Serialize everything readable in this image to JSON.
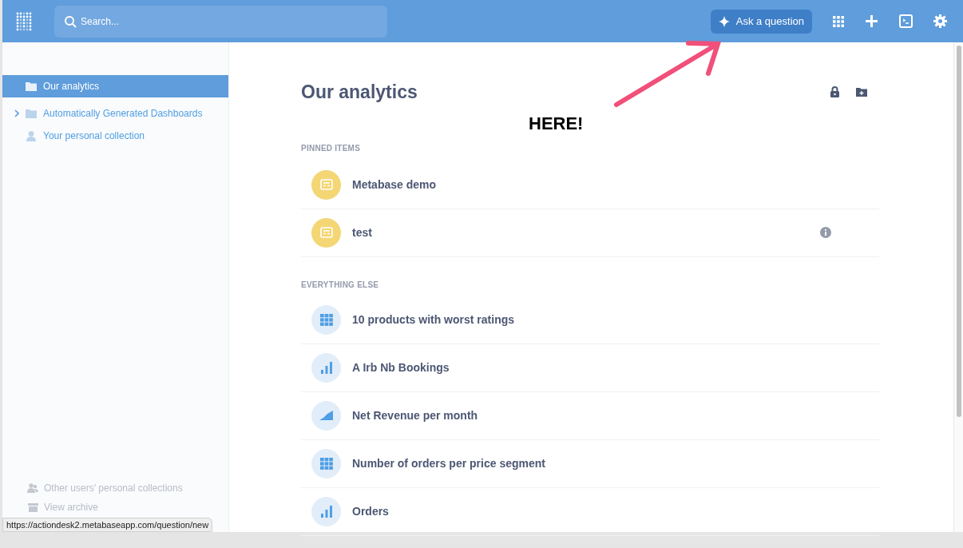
{
  "top_bar": {
    "search": {
      "placeholder": "Search..."
    },
    "ask_button": "Ask a question"
  },
  "sidebar": {
    "items": [
      {
        "label": "Our analytics",
        "kind": "folder",
        "selected": true,
        "expandable": false
      },
      {
        "label": "Automatically Generated Dashboards",
        "kind": "folder",
        "selected": false,
        "expandable": true
      },
      {
        "label": "Your personal collection",
        "kind": "person",
        "selected": false,
        "expandable": false
      }
    ],
    "footer": [
      {
        "label": "Other users' personal collections",
        "kind": "people"
      },
      {
        "label": "View archive",
        "kind": "archive"
      }
    ]
  },
  "main": {
    "title": "Our analytics",
    "pinned": {
      "heading": "PINNED ITEMS",
      "items": [
        {
          "name": "Metabase demo",
          "kind": "dashboard",
          "info": false
        },
        {
          "name": "test",
          "kind": "dashboard",
          "info": true
        }
      ]
    },
    "everything_else": {
      "heading": "EVERYTHING ELSE",
      "items": [
        {
          "name": "10 products with worst ratings",
          "kind": "table"
        },
        {
          "name": "A Irb Nb Bookings",
          "kind": "bar"
        },
        {
          "name": "Net Revenue per month",
          "kind": "area"
        },
        {
          "name": "Number of orders per price segment",
          "kind": "table"
        },
        {
          "name": "Orders",
          "kind": "bar"
        }
      ]
    }
  },
  "annotation": {
    "text": "HERE!"
  },
  "status_url": "https://actiondesk2.metabaseapp.com/question/new"
}
